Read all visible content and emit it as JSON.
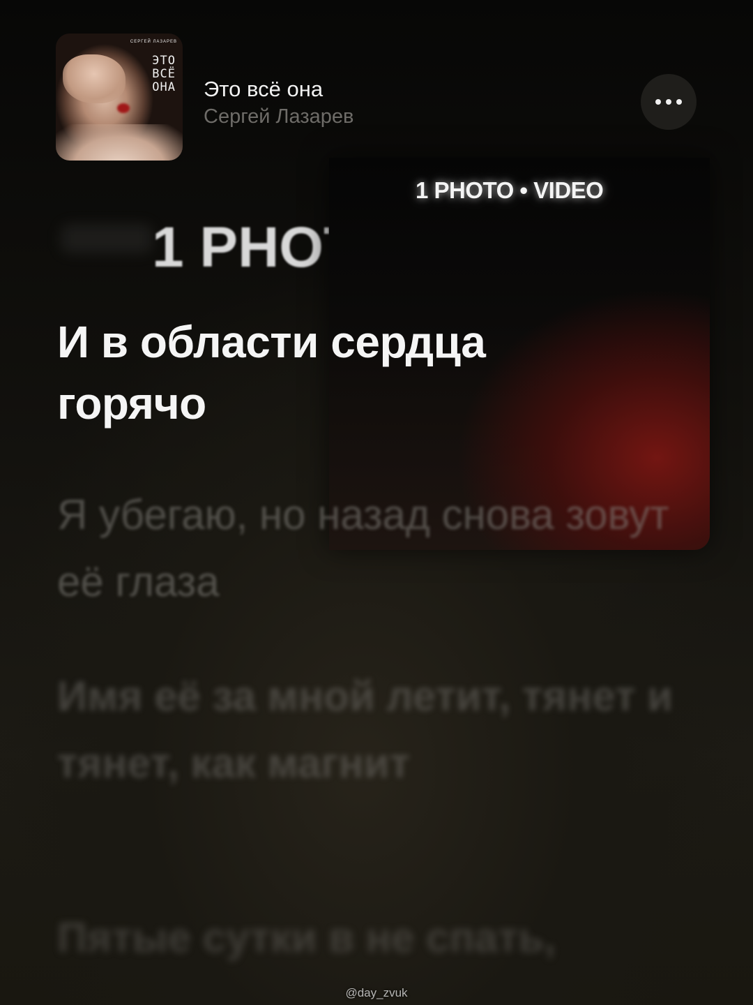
{
  "track": {
    "title": "Это всё она",
    "artist": "Сергей Лазарев"
  },
  "cover": {
    "artist_small": "СЕРГЕЙ ЛАЗАРЕВ",
    "title_lines": [
      "ЭТО",
      "ВСЁ",
      "ОНА"
    ]
  },
  "more_button": {
    "icon": "more-horizontal-icon"
  },
  "overlay": {
    "label": "1 PHOTO • VIDEO",
    "background_text": "1 PHOTO"
  },
  "lyrics": {
    "active": "И в области сердца горячо",
    "next": [
      "Я убегаю, но назад снова зовут её глаза",
      "Имя её за мной летит, тянет и тянет, как магнит",
      "Пятые сутки в не спать,"
    ]
  },
  "watermark": "@day_zvuk",
  "colors": {
    "background": "#0c0b09",
    "active_lyric": "#f5f5f5",
    "artist_text": "#6e6c68",
    "overlay_accent": "#781612"
  }
}
